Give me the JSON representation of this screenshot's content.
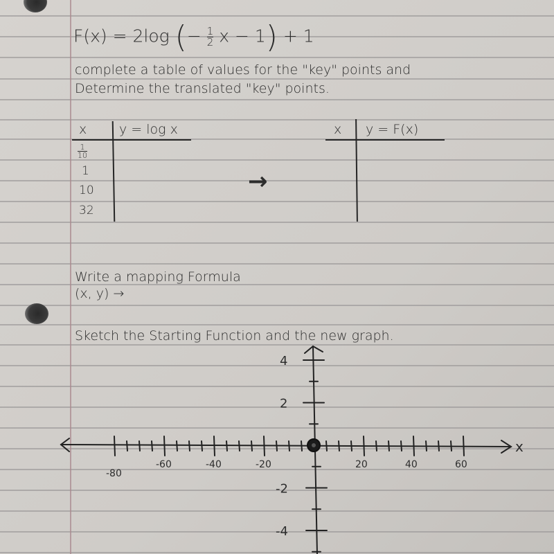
{
  "worksheet": {
    "function": {
      "lhs": "F(x) =",
      "coefficient": "2log",
      "inner_prefix": "−",
      "frac_num": "1",
      "frac_den": "2",
      "inner_suffix": "x − 1",
      "outer": "+ 1"
    },
    "instructions": {
      "line1": "complete a table of values for the \"key\" points and",
      "line2": "Determine the translated \"key\" points."
    },
    "table_left": {
      "headers": [
        "x",
        "y = log x"
      ],
      "x_values": [
        {
          "type": "fraction",
          "num": "1",
          "den": "10"
        },
        {
          "type": "text",
          "value": "1"
        },
        {
          "type": "text",
          "value": "10"
        },
        {
          "type": "text",
          "value": "32"
        }
      ],
      "y_values": [
        "",
        "",
        "",
        ""
      ]
    },
    "arrow": "→",
    "table_right": {
      "headers": [
        "x",
        "y = F(x)"
      ],
      "rows": [
        [
          "",
          ""
        ],
        [
          "",
          ""
        ],
        [
          "",
          ""
        ],
        [
          "",
          ""
        ]
      ]
    },
    "mapping": {
      "prompt": "Write a mapping Formula",
      "formula": "(x, y) →"
    },
    "sketch": {
      "prompt": "Sketch the Starting Function and the new graph."
    }
  },
  "chart_data": {
    "type": "line",
    "title": "",
    "xlabel": "x",
    "ylabel": "",
    "xlim": [
      -85,
      68
    ],
    "ylim": [
      -5,
      4.5
    ],
    "x_ticks_major": [
      -80,
      -60,
      -40,
      -20,
      20,
      40,
      60
    ],
    "x_tick_labels": [
      "-80",
      "-60",
      "-40",
      "-20",
      "20",
      "40",
      "60"
    ],
    "x_ticks_minor": [
      -75,
      -70,
      -65,
      -55,
      -50,
      -45,
      -35,
      -30,
      -25,
      -15,
      -10,
      -5,
      5,
      10,
      15,
      25,
      30,
      35,
      45,
      50,
      55
    ],
    "y_ticks": [
      4,
      3,
      2,
      1,
      -1,
      -2,
      -3,
      -4,
      -5
    ],
    "y_tick_labels": {
      "4": "4",
      "2": "2",
      "-2": "-2",
      "-4": "-4"
    },
    "origin_marker": "filled-circle",
    "series": []
  }
}
